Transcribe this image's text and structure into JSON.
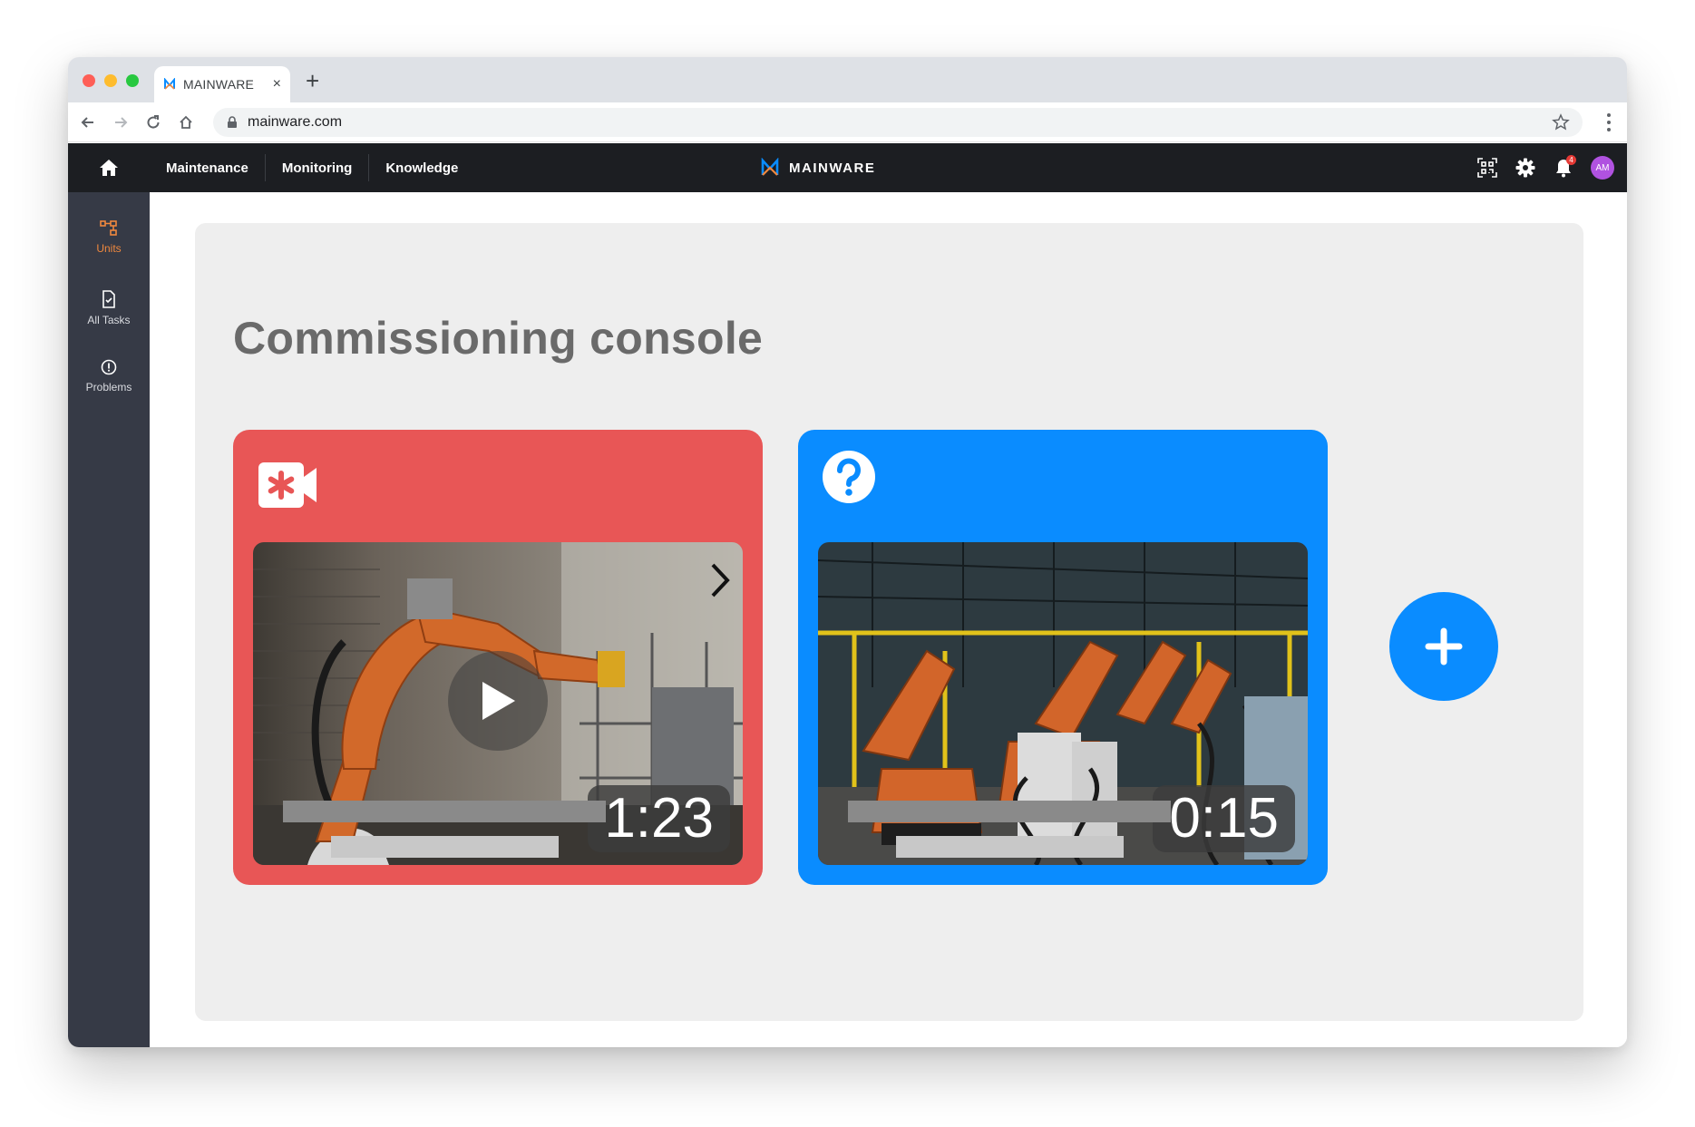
{
  "browser": {
    "tab_title": "MAINWARE",
    "new_tab_symbol": "+",
    "tab_close_symbol": "×",
    "url": "mainware.com"
  },
  "header": {
    "menu": [
      {
        "label": "Maintenance"
      },
      {
        "label": "Monitoring"
      },
      {
        "label": "Knowledge"
      }
    ],
    "brand": "MAINWARE",
    "avatar_initials": "AM",
    "notification_count": "4"
  },
  "sidebar": {
    "items": [
      {
        "label": "Units",
        "icon": "units-icon",
        "active": true
      },
      {
        "label": "All Tasks",
        "icon": "task-file-icon",
        "active": false
      },
      {
        "label": "Problems",
        "icon": "alert-circle-icon",
        "active": false
      }
    ]
  },
  "page": {
    "title": "Commissioning console"
  },
  "cards": [
    {
      "type": "video-record",
      "icon": "video-record-icon",
      "color": "#e85656",
      "duration": "1:23"
    },
    {
      "type": "question",
      "icon": "question-icon",
      "color": "#0a8cff",
      "duration": "0:15"
    }
  ],
  "colors": {
    "accent": "#0a8cff",
    "alert": "#e85656",
    "header_bg": "#1c1e22",
    "sidebar_bg": "#363a46",
    "active_nav": "#f0883e"
  }
}
